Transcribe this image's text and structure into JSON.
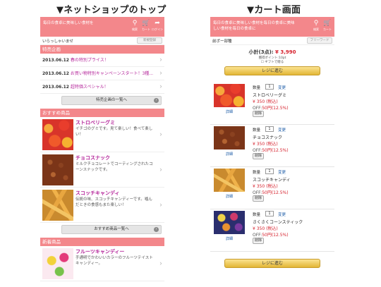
{
  "headings": {
    "left": "▼ネットショップのトップ",
    "right": "▼カート画面"
  },
  "icons": {
    "search": "検索",
    "cart": "カート",
    "login": "ログイン"
  },
  "left": {
    "tagline": "毎日の食卓に美味しい食材を",
    "welcome": "いらっしゃいませ",
    "register_btn": "新規登録",
    "section_news": "特売企画",
    "news": [
      {
        "date": "2013.06.12",
        "title": "春の特別プライス！"
      },
      {
        "date": "2013.06.12",
        "title": "お買い物特別キャンペーンスタート！3種..."
      },
      {
        "date": "2013.06.12",
        "title": "超特価スペシャル！"
      }
    ],
    "news_more": "特売企画の一覧へ",
    "section_recommend": "おすすめ商品",
    "recommend": [
      {
        "name": "ストロベリーグミ",
        "desc": "イチゴのグミです。見て楽しい！食べて楽しい！",
        "color": "red"
      },
      {
        "name": "チョコスナック",
        "desc": "ミルクチョコレートでコーティングされたコーンスナックです。",
        "color": "brown"
      },
      {
        "name": "スコッチキャンディ",
        "desc": "伝統の味、スコッチキャンディーです。噛んだときの食感もまた楽しい！",
        "color": "gold"
      }
    ],
    "recommend_more": "おすすめ商品一覧へ",
    "section_new": "新着商品",
    "new_items": [
      {
        "name": "フルーツキャンディー",
        "desc": "手通明でかわいいカラーのフルーツテイストキャンディー。",
        "color": "fruit"
      }
    ]
  },
  "right": {
    "tagline": "毎日の食卓に美味しい食材を毎日の食卓に美味しい食材を毎日の食卓に",
    "breadcrumb": "前ポー部種",
    "search_btn": "フリーワード",
    "subtotal_label": "小計(3点):",
    "subtotal_price": "¥ 3,990",
    "points": "獲得ポイント:10pt",
    "gift": "ギフトで贈る",
    "checkout": "レジに進む",
    "qty_label": "数量",
    "change": "変更",
    "delete": "削除",
    "detail": "詳細",
    "items": [
      {
        "name": "ストロベリーグミ",
        "qty": "1",
        "price": "¥ 350 (税込)",
        "off": "OFF:",
        "off_val": "50円(12.5%)",
        "color": "red"
      },
      {
        "name": "チョコスナック",
        "qty": "1",
        "price": "¥ 350 (税込)",
        "off": "OFF:",
        "off_val": "50円(12.5%)",
        "color": "brown"
      },
      {
        "name": "スコッチキャンディ",
        "qty": "1",
        "price": "¥ 350 (税込)",
        "off": "OFF:",
        "off_val": "50円(12.5%)",
        "color": "gold"
      },
      {
        "name": "さくさくコーンスティック",
        "qty": "1",
        "price": "¥ 350 (税込)",
        "off": "OFF:",
        "off_val": "50円(12.5%)",
        "color": "mix"
      }
    ]
  },
  "colors": {
    "header_pink": "#f3878b",
    "accent_purple": "#b5279b",
    "price_red": "#d51f2b",
    "link_blue": "#1a5aa6"
  }
}
